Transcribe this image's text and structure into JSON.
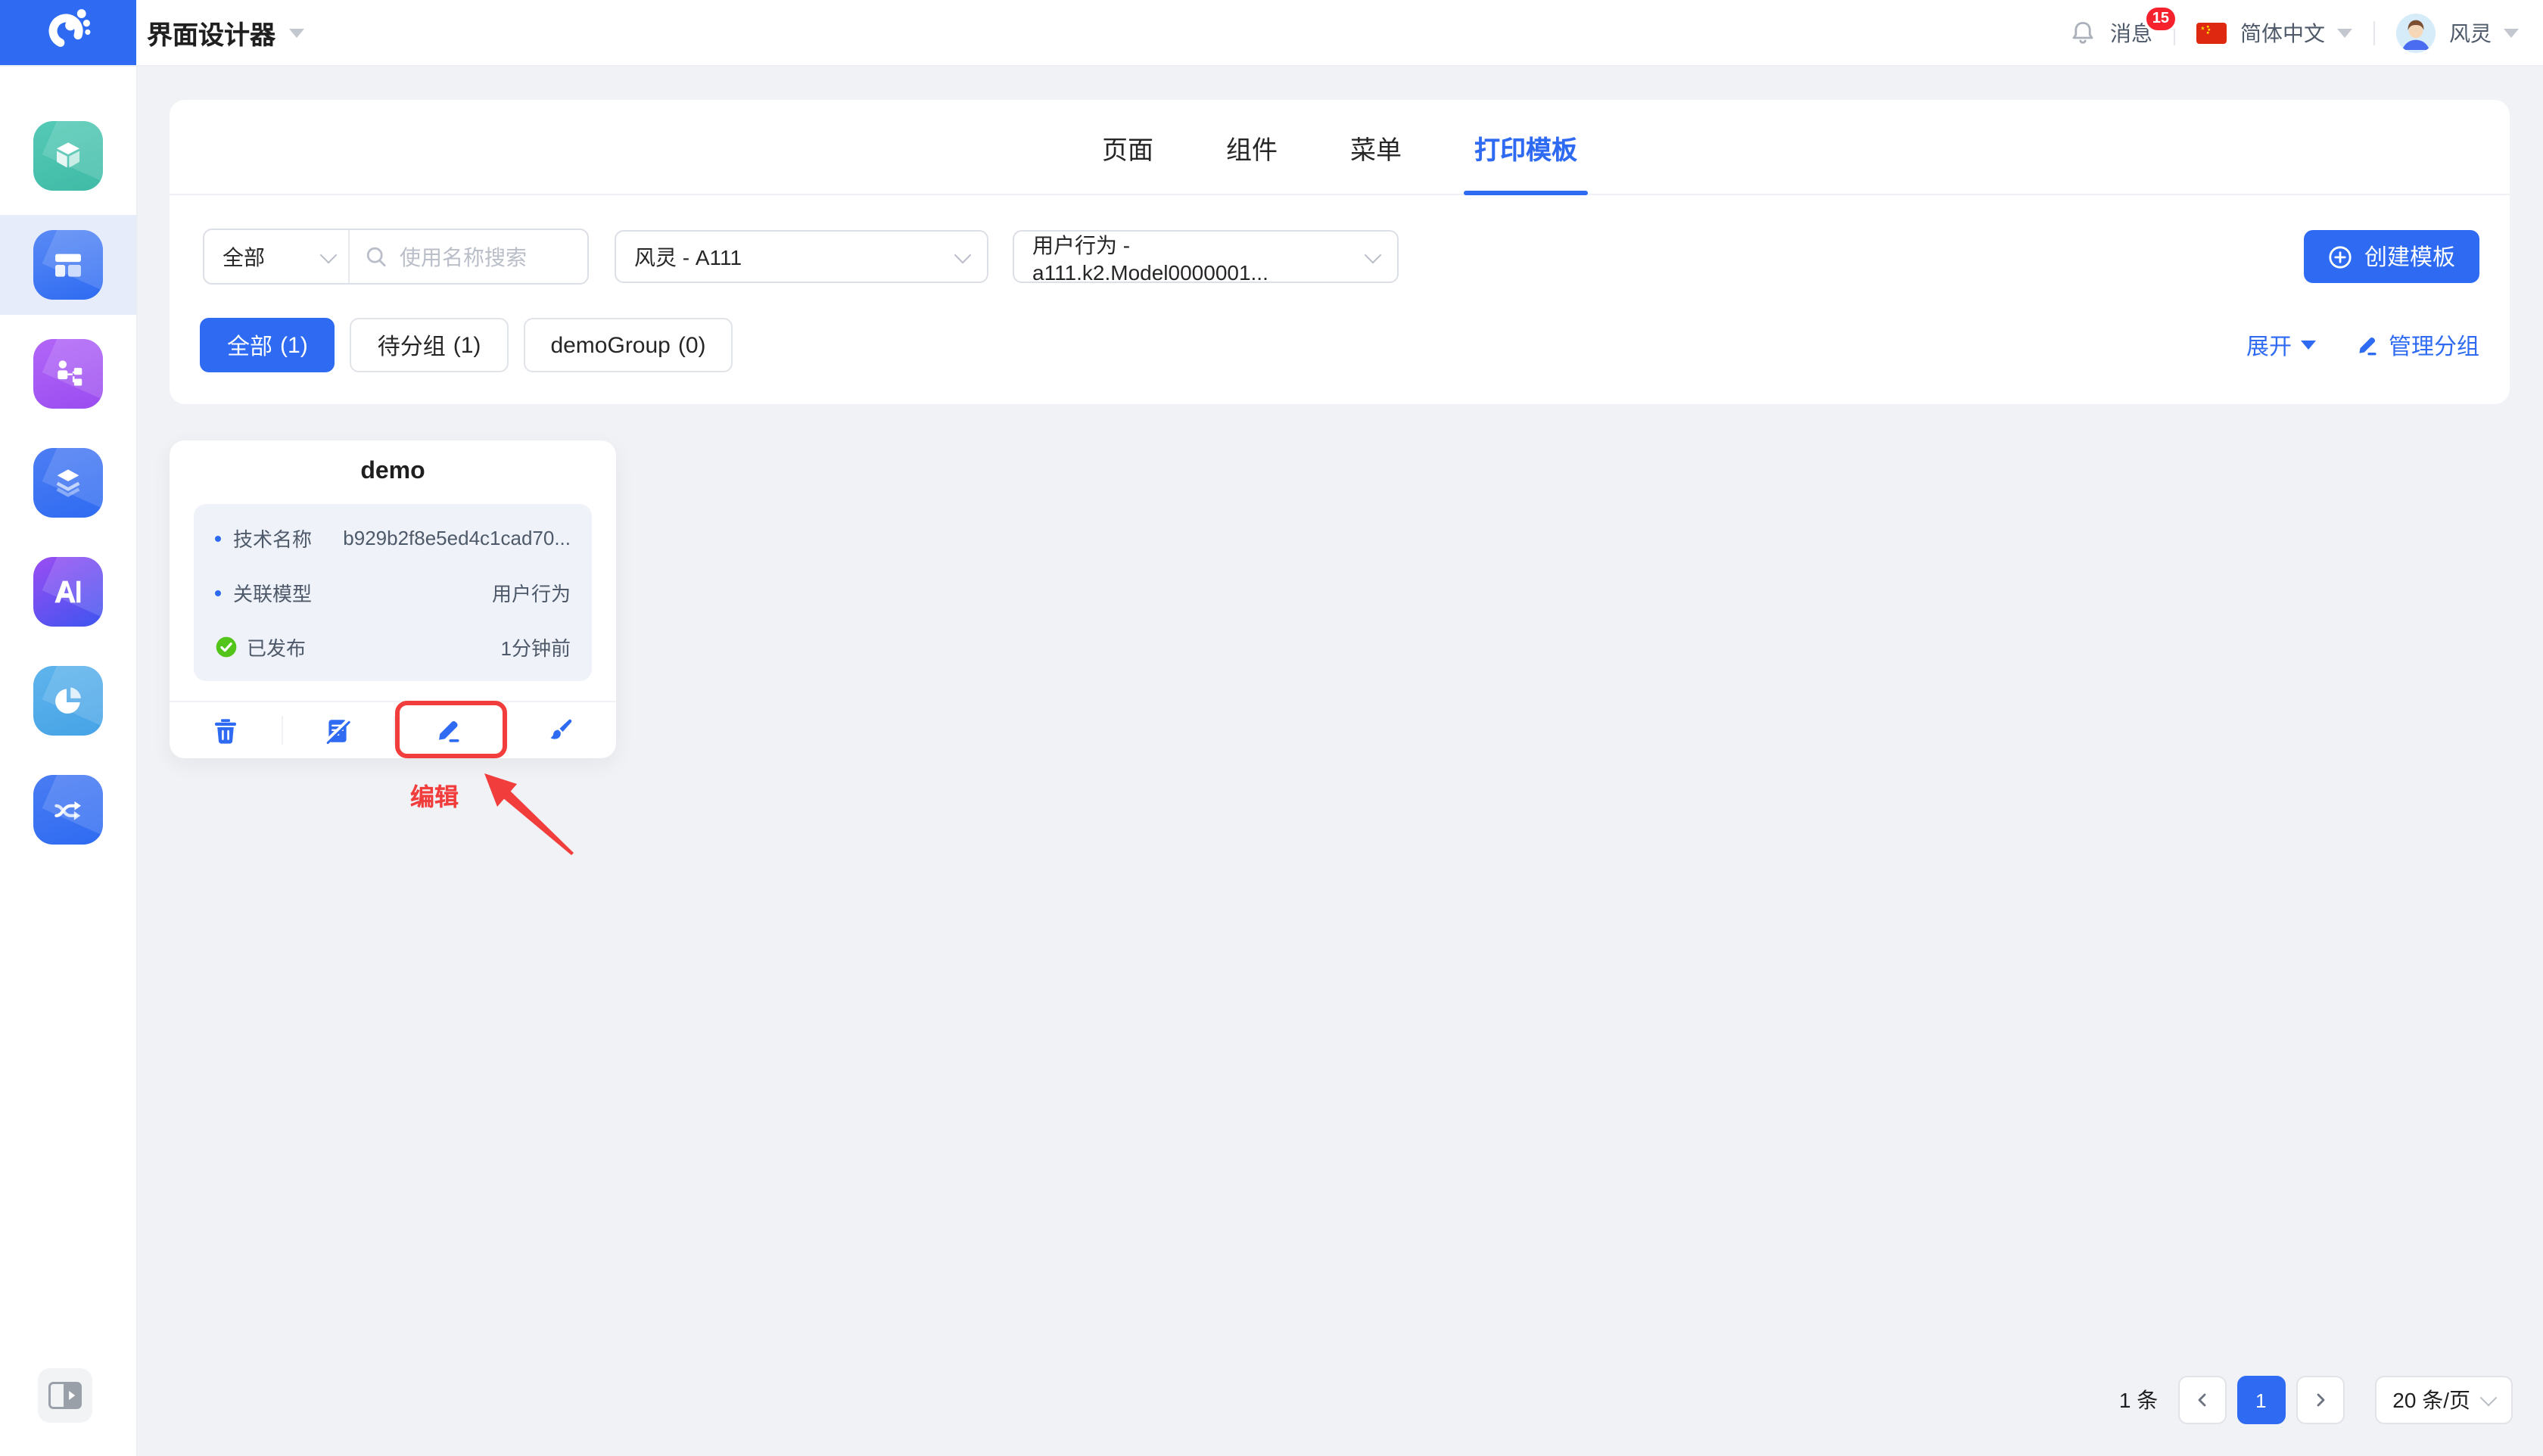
{
  "colors": {
    "accent_blue": "#2e6bf2",
    "annotation_red": "#f23d3d",
    "success_green": "#52c41a",
    "badge_red": "#f5222d",
    "page_background": "#f0f2f6"
  },
  "header": {
    "app_title": "界面设计器",
    "messages_label": "消息",
    "messages_badge": "15",
    "language_label": "简体中文",
    "username": "风灵"
  },
  "sidebar": {
    "items": [
      {
        "icon": "cube-icon"
      },
      {
        "icon": "layout-icon",
        "active": true
      },
      {
        "icon": "flow-icon"
      },
      {
        "icon": "layers-icon"
      },
      {
        "icon": "ai-icon"
      },
      {
        "icon": "pie-chart-icon"
      },
      {
        "icon": "shuffle-icon"
      }
    ]
  },
  "tabs": [
    {
      "label": "页面"
    },
    {
      "label": "组件"
    },
    {
      "label": "菜单"
    },
    {
      "label": "打印模板",
      "active": true
    }
  ],
  "filters": {
    "scope_value": "全部",
    "search_placeholder": "使用名称搜索",
    "app_value": "风灵 - A111",
    "model_value": "用户行为 - a111.k2.Model0000001...",
    "create_button_label": "创建模板"
  },
  "groups": {
    "items": [
      {
        "label": "全部",
        "count": "(1)",
        "active": true
      },
      {
        "label": "待分组",
        "count": "(1)"
      },
      {
        "label": "demoGroup",
        "count": "(0)"
      }
    ],
    "expand_label": "展开",
    "manage_label": "管理分组"
  },
  "template_card": {
    "title": "demo",
    "fields": [
      {
        "label": "技术名称",
        "value": "b929b2f8e5ed4c1cad70..."
      },
      {
        "label": "关联模型",
        "value": "用户行为"
      }
    ],
    "status": {
      "label": "已发布",
      "time": "1分钟前"
    }
  },
  "annotation": {
    "label": "编辑"
  },
  "pagination": {
    "total_label": "1 条",
    "prev_glyph": "‹",
    "current_page": "1",
    "next_glyph": "›",
    "page_size_label": "20 条/页"
  }
}
